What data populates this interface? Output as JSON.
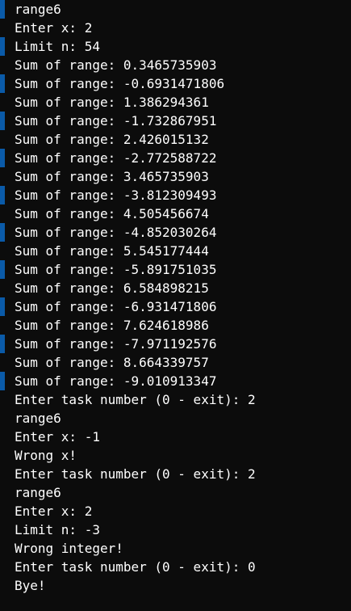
{
  "lines": [
    "range6",
    "Enter x: 2",
    "Limit n: 54",
    "Sum of range: 0.3465735903",
    "Sum of range: -0.6931471806",
    "Sum of range: 1.386294361",
    "Sum of range: -1.732867951",
    "Sum of range: 2.426015132",
    "Sum of range: -2.772588722",
    "Sum of range: 3.465735903",
    "Sum of range: -3.812309493",
    "Sum of range: 4.505456674",
    "Sum of range: -4.852030264",
    "Sum of range: 5.545177444",
    "Sum of range: -5.891751035",
    "Sum of range: 6.584898215",
    "Sum of range: -6.931471806",
    "Sum of range: 7.624618986",
    "Sum of range: -7.971192576",
    "Sum of range: 8.664339757",
    "Sum of range: -9.010913347",
    "Enter task number (0 - exit): 2",
    "range6",
    "Enter x: -1",
    "Wrong x!",
    "Enter task number (0 - exit): 2",
    "range6",
    "Enter x: 2",
    "Limit n: -3",
    "Wrong integer!",
    "Enter task number (0 - exit): 0",
    "Bye!"
  ],
  "colors": {
    "background": "#0c0c0c",
    "text": "#ffffff",
    "edge_accent": "#0a5aa8"
  }
}
